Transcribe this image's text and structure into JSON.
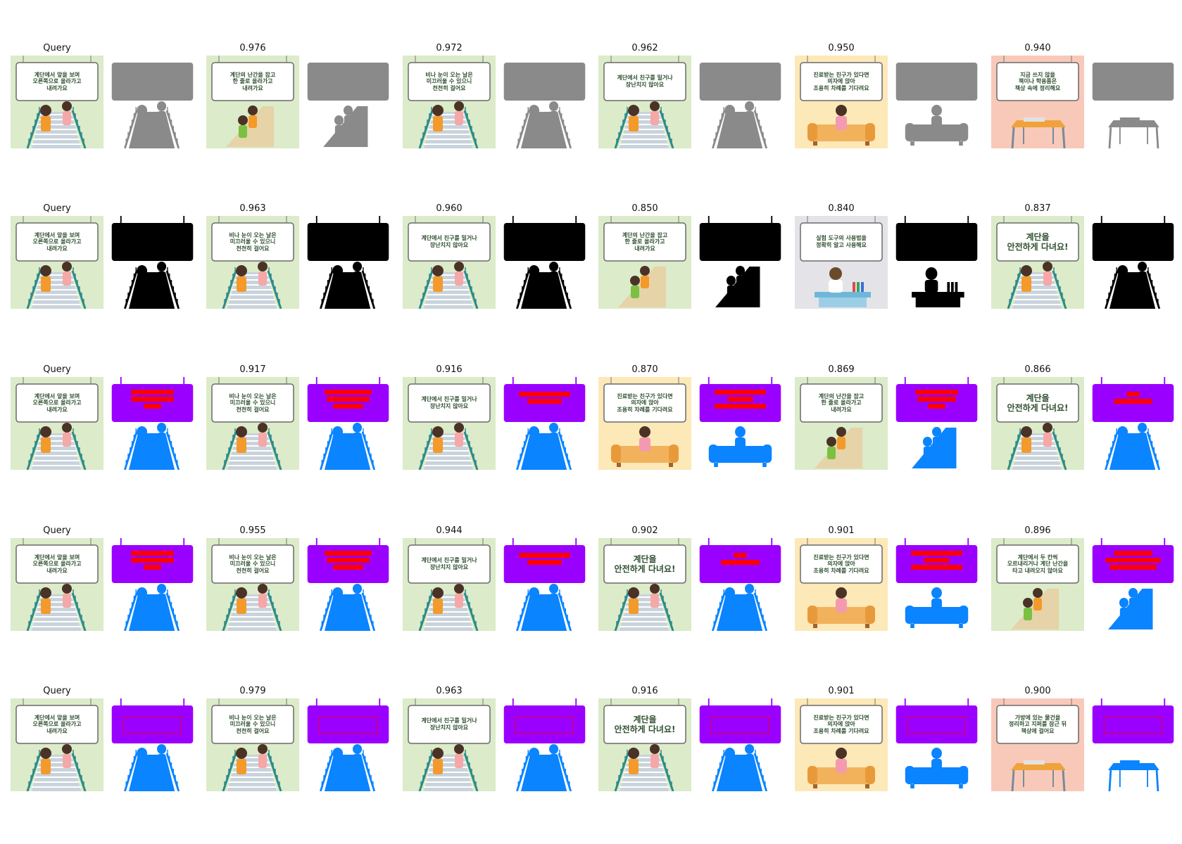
{
  "palette": {
    "green_bg": "#dcebc9",
    "yellow_bg": "#fde8b8",
    "pink_bg": "#f8c9b9",
    "gray_bg": "#e4e4e8",
    "board_border": "#6b6b6b",
    "board_text": "#2f4f2f",
    "mask_gray": "#8a8a8a",
    "mask_black": "#000000",
    "mask_purple": "#9a00ff",
    "mask_blue": "#0a84ff",
    "mask_red": "#ff0000"
  },
  "rows": [
    {
      "mask_style": "gray",
      "cells": [
        {
          "title": "Query",
          "bg": "green",
          "scene": "stairs",
          "text": [
            "계단에서 앞을 보며",
            "오른쪽으로 올라가고",
            "내려가요"
          ]
        },
        {
          "title": "0.976",
          "bg": "green",
          "scene": "ramp",
          "text": [
            "계단의 난간을 잡고",
            "한 줄로 올라가고",
            "내려가요"
          ]
        },
        {
          "title": "0.972",
          "bg": "green",
          "scene": "stairs",
          "text": [
            "비나 눈이 오는 날은",
            "미끄러울 수 있으니",
            "천천히 걸어요"
          ]
        },
        {
          "title": "0.962",
          "bg": "green",
          "scene": "stairs",
          "text": [
            "계단에서 친구를 밀거나",
            "장난치지 않아요"
          ]
        },
        {
          "title": "0.950",
          "bg": "yellow",
          "scene": "sofa",
          "text": [
            "진료받는 친구가 있다면",
            "의자에 앉아",
            "조용히 차례를 기다려요"
          ]
        },
        {
          "title": "0.940",
          "bg": "pink",
          "scene": "desk",
          "text": [
            "지금 쓰지 않을",
            "책이나 학용품은",
            "책상 속에 정리해요"
          ]
        }
      ]
    },
    {
      "mask_style": "black",
      "cells": [
        {
          "title": "Query",
          "bg": "green",
          "scene": "stairs",
          "text": [
            "계단에서 앞을 보며",
            "오른쪽으로 올라가고",
            "내려가요"
          ]
        },
        {
          "title": "0.963",
          "bg": "green",
          "scene": "stairs",
          "text": [
            "비나 눈이 오는 날은",
            "미끄러울 수 있으니",
            "천천히 걸어요"
          ]
        },
        {
          "title": "0.960",
          "bg": "green",
          "scene": "stairs",
          "text": [
            "계단에서 친구를 밀거나",
            "장난치지 않아요"
          ]
        },
        {
          "title": "0.850",
          "bg": "green",
          "scene": "ramp",
          "text": [
            "계단의 난간을 잡고",
            "한 줄로 올라가고",
            "내려가요"
          ]
        },
        {
          "title": "0.840",
          "bg": "gray",
          "scene": "lab",
          "text": [
            "실험 도구의 사용법을",
            "정확히 알고 사용해요"
          ]
        },
        {
          "title": "0.837",
          "bg": "green",
          "scene": "stairs",
          "text": [
            "계단을",
            "안전하게 다녀요!"
          ],
          "big": true
        }
      ]
    },
    {
      "mask_style": "color",
      "cells": [
        {
          "title": "Query",
          "bg": "green",
          "scene": "stairs",
          "text": [
            "계단에서 앞을 보며",
            "오른쪽으로 올라가고",
            "내려가요"
          ]
        },
        {
          "title": "0.917",
          "bg": "green",
          "scene": "stairs",
          "text": [
            "비나 눈이 오는 날은",
            "미끄러울 수 있으니",
            "천천히 걸어요"
          ]
        },
        {
          "title": "0.916",
          "bg": "green",
          "scene": "stairs",
          "text": [
            "계단에서 친구를 밀거나",
            "장난치지 않아요"
          ]
        },
        {
          "title": "0.870",
          "bg": "yellow",
          "scene": "sofa",
          "text": [
            "진료받는 친구가 있다면",
            "의자에 앉아",
            "조용히 차례를 기다려요"
          ]
        },
        {
          "title": "0.869",
          "bg": "green",
          "scene": "ramp",
          "text": [
            "계단의 난간을 잡고",
            "한 줄로 올라가고",
            "내려가요"
          ]
        },
        {
          "title": "0.866",
          "bg": "green",
          "scene": "stairs",
          "text": [
            "계단을",
            "안전하게 다녀요!"
          ],
          "big": true
        }
      ]
    },
    {
      "mask_style": "color",
      "cells": [
        {
          "title": "Query",
          "bg": "green",
          "scene": "stairs",
          "text": [
            "계단에서 앞을 보며",
            "오른쪽으로 올라가고",
            "내려가요"
          ]
        },
        {
          "title": "0.955",
          "bg": "green",
          "scene": "stairs",
          "text": [
            "비나 눈이 오는 날은",
            "미끄러울 수 있으니",
            "천천히 걸어요"
          ]
        },
        {
          "title": "0.944",
          "bg": "green",
          "scene": "stairs",
          "text": [
            "계단에서 친구를 밀거나",
            "장난치지 않아요"
          ]
        },
        {
          "title": "0.902",
          "bg": "green",
          "scene": "stairs",
          "text": [
            "계단을",
            "안전하게 다녀요!"
          ],
          "big": true
        },
        {
          "title": "0.901",
          "bg": "yellow",
          "scene": "sofa",
          "text": [
            "진료받는 친구가 있다면",
            "의자에 앉아",
            "조용히 차례를 기다려요"
          ]
        },
        {
          "title": "0.896",
          "bg": "green",
          "scene": "ramp",
          "text": [
            "계단에서 두 칸씩",
            "오르내리거나 계단 난간을",
            "타고 내려오지 않아요"
          ]
        }
      ]
    },
    {
      "mask_style": "box",
      "cells": [
        {
          "title": "Query",
          "bg": "green",
          "scene": "stairs",
          "text": [
            "계단에서 앞을 보며",
            "오른쪽으로 올라가고",
            "내려가요"
          ]
        },
        {
          "title": "0.979",
          "bg": "green",
          "scene": "stairs",
          "text": [
            "비나 눈이 오는 날은",
            "미끄러울 수 있으니",
            "천천히 걸어요"
          ]
        },
        {
          "title": "0.963",
          "bg": "green",
          "scene": "stairs",
          "text": [
            "계단에서 친구를 밀거나",
            "장난치지 않아요"
          ]
        },
        {
          "title": "0.916",
          "bg": "green",
          "scene": "stairs",
          "text": [
            "계단을",
            "안전하게 다녀요!"
          ],
          "big": true
        },
        {
          "title": "0.901",
          "bg": "yellow",
          "scene": "sofa",
          "text": [
            "진료받는 친구가 있다면",
            "의자에 앉아",
            "조용히 차례를 기다려요"
          ]
        },
        {
          "title": "0.900",
          "bg": "pink",
          "scene": "desk",
          "text": [
            "가방에 있는 물건을",
            "정리하고 지퍼를 잠근 뒤",
            "책상에 걸어요"
          ]
        }
      ]
    }
  ]
}
